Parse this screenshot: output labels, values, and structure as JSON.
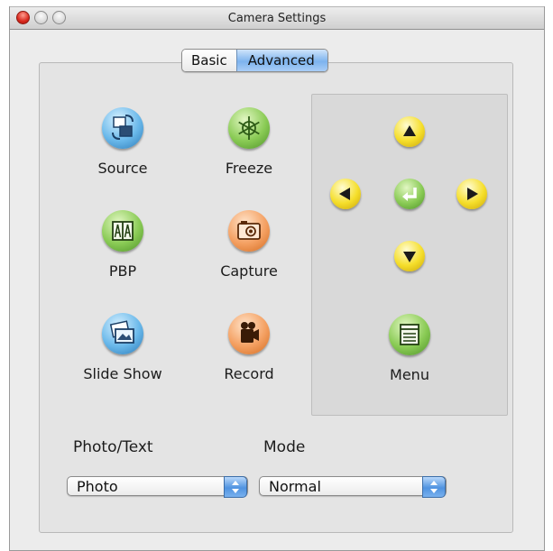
{
  "window": {
    "title": "Camera Settings"
  },
  "tabs": [
    {
      "label": "Basic",
      "selected": false
    },
    {
      "label": "Advanced",
      "selected": true
    }
  ],
  "buttons": {
    "source": {
      "label": "Source",
      "icon": "source-icon"
    },
    "freeze": {
      "label": "Freeze",
      "icon": "freeze-icon"
    },
    "pbp": {
      "label": "PBP",
      "icon": "pbp-icon"
    },
    "capture": {
      "label": "Capture",
      "icon": "camera-icon"
    },
    "slideshow": {
      "label": "Slide Show",
      "icon": "slideshow-icon"
    },
    "record": {
      "label": "Record",
      "icon": "video-camera-icon"
    }
  },
  "navigation": {
    "up": "arrow-up-icon",
    "down": "arrow-down-icon",
    "left": "arrow-left-icon",
    "right": "arrow-right-icon",
    "enter": "enter-icon",
    "menu_label": "Menu"
  },
  "fields": {
    "photo_text_label": "Photo/Text",
    "photo_text_value": "Photo",
    "mode_label": "Mode",
    "mode_value": "Normal"
  },
  "colors": {
    "accent": "#4f93e0",
    "nav_yellow": "#f5de2a",
    "enter_green": "#8acb55"
  }
}
